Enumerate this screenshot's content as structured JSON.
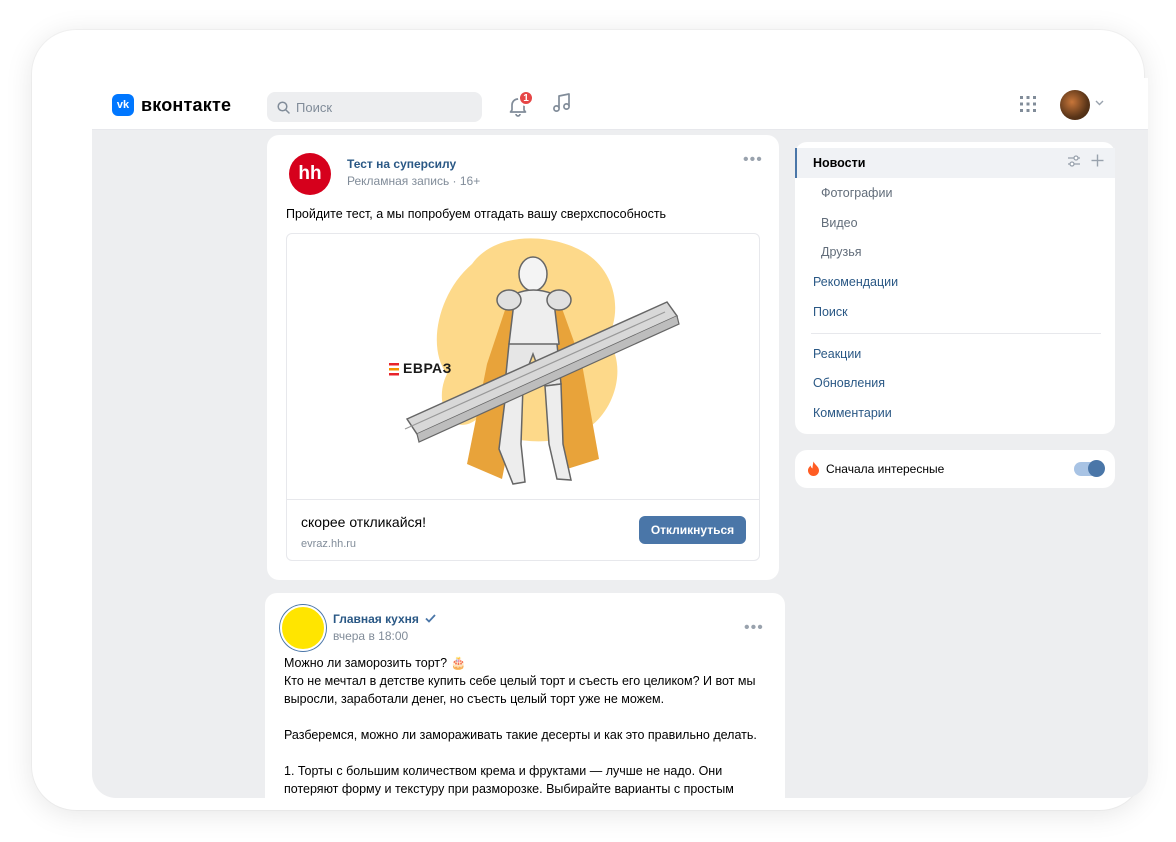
{
  "header": {
    "logo_mark": "vk",
    "logo_text": "вконтакте",
    "search_placeholder": "Поиск",
    "notifications_badge": "1"
  },
  "ad_post": {
    "author": "Тест на суперсилу",
    "meta": "Рекламная запись · 16+",
    "logo_text": "hh",
    "text": "Пройдите тест, а мы попробуем отгадать вашу сверхспособность",
    "brand": "ЕВРАЗ",
    "slogan": "скорее откликайся!",
    "domain": "evraz.hh.ru",
    "cta_label": "Откликнуться"
  },
  "post": {
    "author": "Главная кухня",
    "time": "вчера в 18:00",
    "lines": [
      "Можно ли заморозить торт? 🎂",
      "Кто не мечтал в детстве купить себе целый торт и съесть его целиком? И вот мы выросли, заработали денег, но съесть целый торт уже не можем.",
      "Разберемся, можно ли замораживать такие десерты и как это правильно делать.",
      "1. Торты с большим количеством крема и фруктами — лучше не надо. Они потеряют форму и текстуру при разморозке. Выбирайте варианты с простым"
    ]
  },
  "menu": {
    "active": "Новости",
    "subitems": [
      "Фотографии",
      "Видео",
      "Друзья"
    ],
    "items": [
      "Рекомендации",
      "Поиск"
    ],
    "items2": [
      "Реакции",
      "Обновления",
      "Комментарии"
    ]
  },
  "interest": {
    "label": "Сначала интересные",
    "enabled": true
  },
  "colors": {
    "link": "#2a5885",
    "accent": "#4a76a8",
    "vk_blue": "#0077ff",
    "badge": "#e64646"
  }
}
